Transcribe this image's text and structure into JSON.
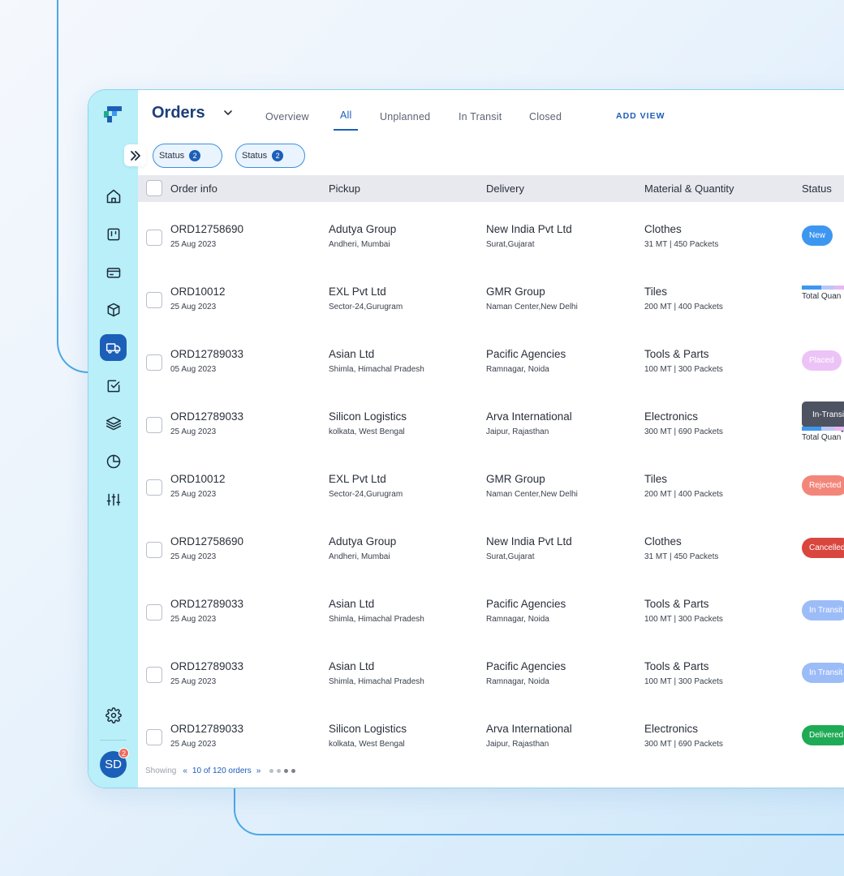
{
  "header": {
    "title": "Orders",
    "tabs": [
      {
        "label": "Overview",
        "active": false
      },
      {
        "label": "All",
        "active": true
      },
      {
        "label": "Unplanned",
        "active": false
      },
      {
        "label": "In Transit",
        "active": false
      },
      {
        "label": "Closed",
        "active": false
      }
    ],
    "add_view": "ADD VIEW"
  },
  "filters": [
    {
      "label": "Status",
      "count": "2"
    },
    {
      "label": "Status",
      "count": "2"
    }
  ],
  "sidebar": {
    "items": [
      {
        "icon": "home-icon",
        "active": false
      },
      {
        "icon": "board-icon",
        "active": false
      },
      {
        "icon": "card-icon",
        "active": false
      },
      {
        "icon": "box-icon",
        "active": false
      },
      {
        "icon": "truck-icon",
        "active": true
      },
      {
        "icon": "checkbox-icon",
        "active": false
      },
      {
        "icon": "layers-icon",
        "active": false
      },
      {
        "icon": "pie-chart-icon",
        "active": false
      },
      {
        "icon": "sliders-icon",
        "active": false
      }
    ],
    "settings_icon": "gear-icon",
    "avatar_initials": "SD",
    "avatar_badge": "2"
  },
  "table": {
    "columns": [
      "Order info",
      "Pickup",
      "Delivery",
      "Material & Quantity",
      "Status"
    ],
    "rows": [
      {
        "order_id": "ORD12758690",
        "date": "25 Aug 2023",
        "pickup": "Adutya Group",
        "pickup_loc": "Andheri, Mumbai",
        "delivery": "New India Pvt Ltd",
        "delivery_loc": "Surat,Gujarat",
        "material": "Clothes",
        "quantity": "31 MT | 450 Packets",
        "status": "New",
        "status_type": "badge",
        "status_bg": "#3d97f0",
        "status_fg": "#ffffff"
      },
      {
        "order_id": "ORD10012",
        "date": "25 Aug 2023",
        "pickup": "EXL Pvt Ltd",
        "pickup_loc": "Sector-24,Gurugram",
        "delivery": "GMR Group",
        "delivery_loc": "Naman Center,New Delhi",
        "material": "Tiles",
        "quantity": "200 MT | 400 Packets",
        "status": "Total Quan",
        "status_type": "progress",
        "status_bg": "",
        "status_fg": ""
      },
      {
        "order_id": "ORD12789033",
        "date": "05 Aug 2023",
        "pickup": "Asian Ltd",
        "pickup_loc": "Shimla, Himachal Pradesh",
        "delivery": "Pacific Agencies",
        "delivery_loc": "Ramnagar, Noida",
        "material": "Tools & Parts",
        "quantity": "100 MT | 300 Packets",
        "status": "Placed",
        "status_type": "badge",
        "status_bg": "#ecc3f7",
        "status_fg": "#ffffff"
      },
      {
        "order_id": "ORD12789033",
        "date": "25 Aug 2023",
        "pickup": "Silicon Logistics",
        "pickup_loc": "kolkata, West Bengal",
        "delivery": "Arva International",
        "delivery_loc": "Jaipur, Rajasthan",
        "material": "Electronics",
        "quantity": "300 MT | 690 Packets",
        "status": "Total Quan",
        "status_type": "progress-tooltip",
        "tooltip": "In-Transit",
        "status_bg": "",
        "status_fg": ""
      },
      {
        "order_id": "ORD10012",
        "date": "25 Aug 2023",
        "pickup": "EXL Pvt Ltd",
        "pickup_loc": "Sector-24,Gurugram",
        "delivery": "GMR Group",
        "delivery_loc": "Naman Center,New Delhi",
        "material": "Tiles",
        "quantity": "200 MT | 400 Packets",
        "status": "Rejected",
        "status_type": "badge",
        "status_bg": "#f3867a",
        "status_fg": "#ffffff"
      },
      {
        "order_id": "ORD12758690",
        "date": "25 Aug 2023",
        "pickup": "Adutya Group",
        "pickup_loc": "Andheri, Mumbai",
        "delivery": "New India Pvt Ltd",
        "delivery_loc": "Surat,Gujarat",
        "material": "Clothes",
        "quantity": "31 MT | 450 Packets",
        "status": "Cancelled",
        "status_type": "badge",
        "status_bg": "#d9463e",
        "status_fg": "#ffffff"
      },
      {
        "order_id": "ORD12789033",
        "date": "25 Aug 2023",
        "pickup": "Asian Ltd",
        "pickup_loc": "Shimla, Himachal Pradesh",
        "delivery": "Pacific Agencies",
        "delivery_loc": "Ramnagar, Noida",
        "material": "Tools & Parts",
        "quantity": "100 MT | 300 Packets",
        "status": "In Transit",
        "status_type": "badge",
        "status_bg": "#9cbcf8",
        "status_fg": "#ffffff"
      },
      {
        "order_id": "ORD12789033",
        "date": "25 Aug 2023",
        "pickup": "Asian Ltd",
        "pickup_loc": "Shimla, Himachal Pradesh",
        "delivery": "Pacific Agencies",
        "delivery_loc": "Ramnagar, Noida",
        "material": "Tools & Parts",
        "quantity": "100 MT | 300 Packets",
        "status": "In Transit",
        "status_type": "badge",
        "status_bg": "#9cbcf8",
        "status_fg": "#ffffff"
      },
      {
        "order_id": "ORD12789033",
        "date": "25 Aug 2023",
        "pickup": "Silicon Logistics",
        "pickup_loc": "kolkata, West Bengal",
        "delivery": "Arva International",
        "delivery_loc": "Jaipur, Rajasthan",
        "material": "Electronics",
        "quantity": "300 MT | 690 Packets",
        "status": "Delivered",
        "status_type": "badge",
        "status_bg": "#1faa55",
        "status_fg": "#ffffff"
      }
    ]
  },
  "footer": {
    "showing_label": "Showing",
    "page_text": "10 of 120 orders"
  },
  "colors": {
    "accent": "#1c5fb8",
    "sidebar_bg": "#b8eff8",
    "progress_segments": [
      "#3d97f0",
      "#b9c7f5",
      "#e7b8f0",
      "#f6c2c2"
    ]
  }
}
